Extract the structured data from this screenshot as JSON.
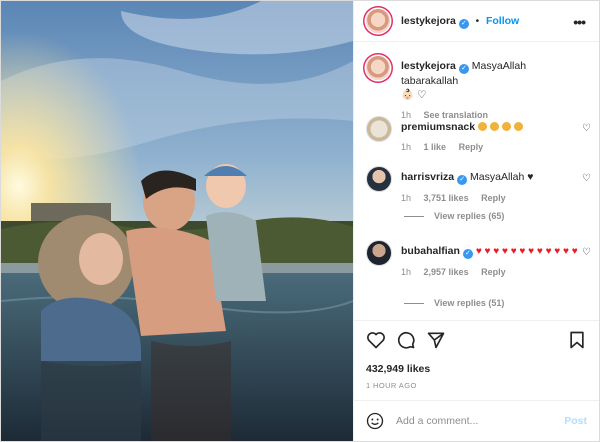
{
  "post": {
    "author": "lestykejora",
    "follow_label": "Follow",
    "dot": "•",
    "more_label": "•••"
  },
  "comments": [
    {
      "user": "lestykejora",
      "text": "MasyaAllah tabarakallah",
      "emoji": "👶🏻 ♡",
      "time": "1h",
      "action": "See translation"
    },
    {
      "user": "premiumsnack",
      "time": "1h",
      "likes": "1 like",
      "reply": "Reply",
      "emoji_count": 4
    },
    {
      "user": "harrisvriza",
      "text": "MasyaAllah ♥",
      "time": "1h",
      "likes": "3,751 likes",
      "reply": "Reply",
      "view_replies": "View replies (65)"
    },
    {
      "user": "bubahalfian",
      "time": "1h",
      "likes": "2,957 likes",
      "reply": "Reply",
      "hearts": "♥ ♥ ♥ ♥ ♥ ♥ ♥ ♥ ♥ ♥ ♥ ♥",
      "view_replies": "View replies (51)"
    }
  ],
  "actions": {
    "likes_count": "432,949 likes",
    "timestamp": "1 HOUR AGO"
  },
  "add_comment": {
    "placeholder": "Add a comment...",
    "post_label": "Post"
  },
  "colors": {
    "accent": "#0095f6",
    "verified": "#3897f0",
    "heart": "#ed1c24"
  }
}
